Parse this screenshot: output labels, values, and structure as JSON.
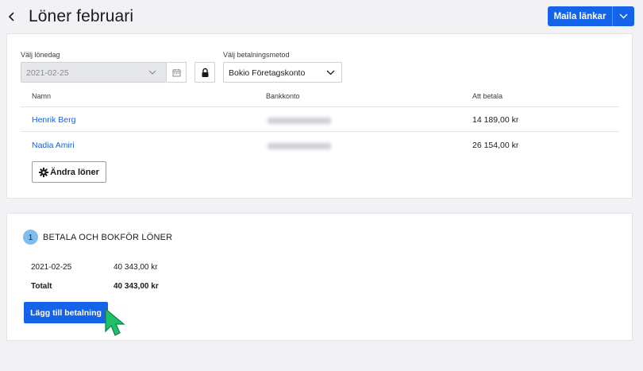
{
  "header": {
    "title": "Löner februari",
    "mail_button_label": "Maila länkar"
  },
  "payday": {
    "label": "Välj lönedag",
    "value": "2021-02-25"
  },
  "payment_method": {
    "label": "Välj betalningsmetod",
    "value": "Bokio Företagskonto"
  },
  "table": {
    "columns": [
      "Namn",
      "Bankkonto",
      "Att betala"
    ],
    "rows": [
      {
        "name": "Henrik Berg",
        "amount": "14 189,00 kr"
      },
      {
        "name": "Nadia Amiri",
        "amount": "26 154,00 kr"
      }
    ]
  },
  "edit_button_label": "Ändra löner",
  "step": {
    "number": "1",
    "title": "BETALA OCH BOKFÖR LÖNER",
    "date": "2021-02-25",
    "date_amount": "40 343,00 kr",
    "total_label": "Totalt",
    "total_amount": "40 343,00 kr",
    "pay_button_label": "Lägg till betalning"
  },
  "colors": {
    "primary": "#1463e8",
    "step_badge": "#7fbdf0",
    "cursor": "#1fbf6a"
  }
}
